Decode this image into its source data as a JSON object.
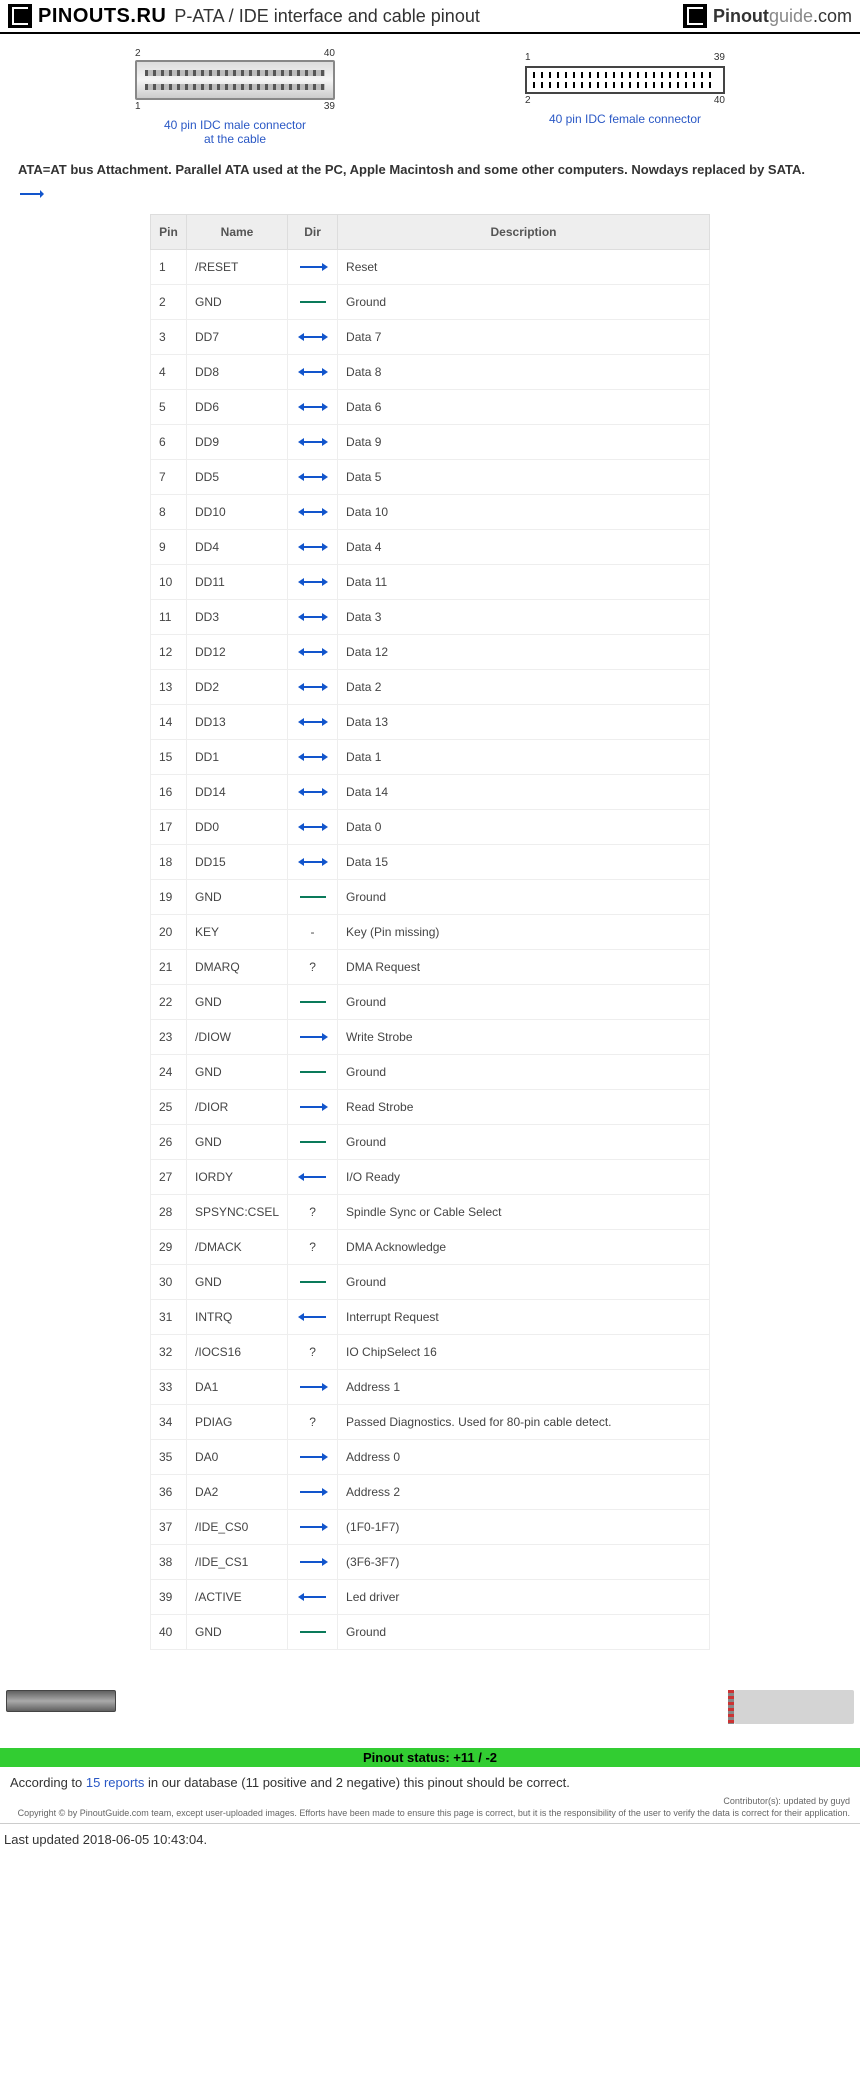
{
  "header": {
    "logo_left": "PINOUTS.RU",
    "title": "P-ATA / IDE interface and cable pinout",
    "logo_right_bold": "Pinout",
    "logo_right_guide": "guide",
    "logo_right_com": ".com"
  },
  "connectors": {
    "male": {
      "tl": "2",
      "tr": "40",
      "bl": "1",
      "br": "39",
      "link": "40 pin IDC male connector",
      "sub": "at the cable"
    },
    "female": {
      "tl": "1",
      "tr": "39",
      "bl": "2",
      "br": "40",
      "link": "40 pin IDC female connector"
    }
  },
  "intro": "ATA=AT bus Attachment. Parallel ATA used at the PC, Apple Macintosh and some other computers. Nowdays replaced by SATA.",
  "table": {
    "headers": [
      "Pin",
      "Name",
      "Dir",
      "Description"
    ],
    "rows": [
      {
        "pin": "1",
        "name": "/RESET",
        "dir": "right",
        "desc": "Reset"
      },
      {
        "pin": "2",
        "name": "GND",
        "dir": "line",
        "desc": "Ground"
      },
      {
        "pin": "3",
        "name": "DD7",
        "dir": "both",
        "desc": "Data 7"
      },
      {
        "pin": "4",
        "name": "DD8",
        "dir": "both",
        "desc": "Data 8"
      },
      {
        "pin": "5",
        "name": "DD6",
        "dir": "both",
        "desc": "Data 6"
      },
      {
        "pin": "6",
        "name": "DD9",
        "dir": "both",
        "desc": "Data 9"
      },
      {
        "pin": "7",
        "name": "DD5",
        "dir": "both",
        "desc": "Data 5"
      },
      {
        "pin": "8",
        "name": "DD10",
        "dir": "both",
        "desc": "Data 10"
      },
      {
        "pin": "9",
        "name": "DD4",
        "dir": "both",
        "desc": "Data 4"
      },
      {
        "pin": "10",
        "name": "DD11",
        "dir": "both",
        "desc": "Data 11"
      },
      {
        "pin": "11",
        "name": "DD3",
        "dir": "both",
        "desc": "Data 3"
      },
      {
        "pin": "12",
        "name": "DD12",
        "dir": "both",
        "desc": "Data 12"
      },
      {
        "pin": "13",
        "name": "DD2",
        "dir": "both",
        "desc": "Data 2"
      },
      {
        "pin": "14",
        "name": "DD13",
        "dir": "both",
        "desc": "Data 13"
      },
      {
        "pin": "15",
        "name": "DD1",
        "dir": "both",
        "desc": "Data 1"
      },
      {
        "pin": "16",
        "name": "DD14",
        "dir": "both",
        "desc": "Data 14"
      },
      {
        "pin": "17",
        "name": "DD0",
        "dir": "both",
        "desc": "Data 0"
      },
      {
        "pin": "18",
        "name": "DD15",
        "dir": "both",
        "desc": "Data 15"
      },
      {
        "pin": "19",
        "name": "GND",
        "dir": "line",
        "desc": "Ground"
      },
      {
        "pin": "20",
        "name": "KEY",
        "dir": "dash",
        "desc": "Key (Pin missing)"
      },
      {
        "pin": "21",
        "name": "DMARQ",
        "dir": "q",
        "desc": "DMA Request"
      },
      {
        "pin": "22",
        "name": "GND",
        "dir": "line",
        "desc": "Ground"
      },
      {
        "pin": "23",
        "name": "/DIOW",
        "dir": "right",
        "desc": "Write Strobe"
      },
      {
        "pin": "24",
        "name": "GND",
        "dir": "line",
        "desc": "Ground"
      },
      {
        "pin": "25",
        "name": "/DIOR",
        "dir": "right",
        "desc": "Read Strobe"
      },
      {
        "pin": "26",
        "name": "GND",
        "dir": "line",
        "desc": "Ground"
      },
      {
        "pin": "27",
        "name": "IORDY",
        "dir": "left",
        "desc": "I/O Ready"
      },
      {
        "pin": "28",
        "name": "SPSYNC:CSEL",
        "dir": "q",
        "desc": "Spindle Sync or Cable Select"
      },
      {
        "pin": "29",
        "name": "/DMACK",
        "dir": "q",
        "desc": "DMA Acknowledge"
      },
      {
        "pin": "30",
        "name": "GND",
        "dir": "line",
        "desc": "Ground"
      },
      {
        "pin": "31",
        "name": "INTRQ",
        "dir": "left",
        "desc": "Interrupt Request"
      },
      {
        "pin": "32",
        "name": "/IOCS16",
        "dir": "q",
        "desc": "IO ChipSelect 16"
      },
      {
        "pin": "33",
        "name": "DA1",
        "dir": "right",
        "desc": "Address 1"
      },
      {
        "pin": "34",
        "name": "PDIAG",
        "dir": "q",
        "desc": "Passed Diagnostics. Used for 80-pin cable detect."
      },
      {
        "pin": "35",
        "name": "DA0",
        "dir": "right",
        "desc": "Address 0"
      },
      {
        "pin": "36",
        "name": "DA2",
        "dir": "right",
        "desc": "Address 2"
      },
      {
        "pin": "37",
        "name": "/IDE_CS0",
        "dir": "right",
        "desc": "(1F0-1F7)"
      },
      {
        "pin": "38",
        "name": "/IDE_CS1",
        "dir": "right",
        "desc": "(3F6-3F7)"
      },
      {
        "pin": "39",
        "name": "/ACTIVE",
        "dir": "left",
        "desc": "Led driver"
      },
      {
        "pin": "40",
        "name": "GND",
        "dir": "line",
        "desc": "Ground"
      }
    ]
  },
  "status": {
    "label": "Pinout status:",
    "value": "+11 / -2",
    "text_before": "According to ",
    "link": "15 reports",
    "text_after": " in our database (11 positive and 2 negative) this pinout should be correct."
  },
  "copyright": {
    "line1": "Contributor(s): updated by guyd",
    "line2": "Copyright © by PinoutGuide.com team, except user-uploaded images. Efforts have been made to ensure this page is correct, but it is the responsibility of the user to verify the data is correct for their application."
  },
  "updated": "Last updated 2018-06-05 10:43:04."
}
